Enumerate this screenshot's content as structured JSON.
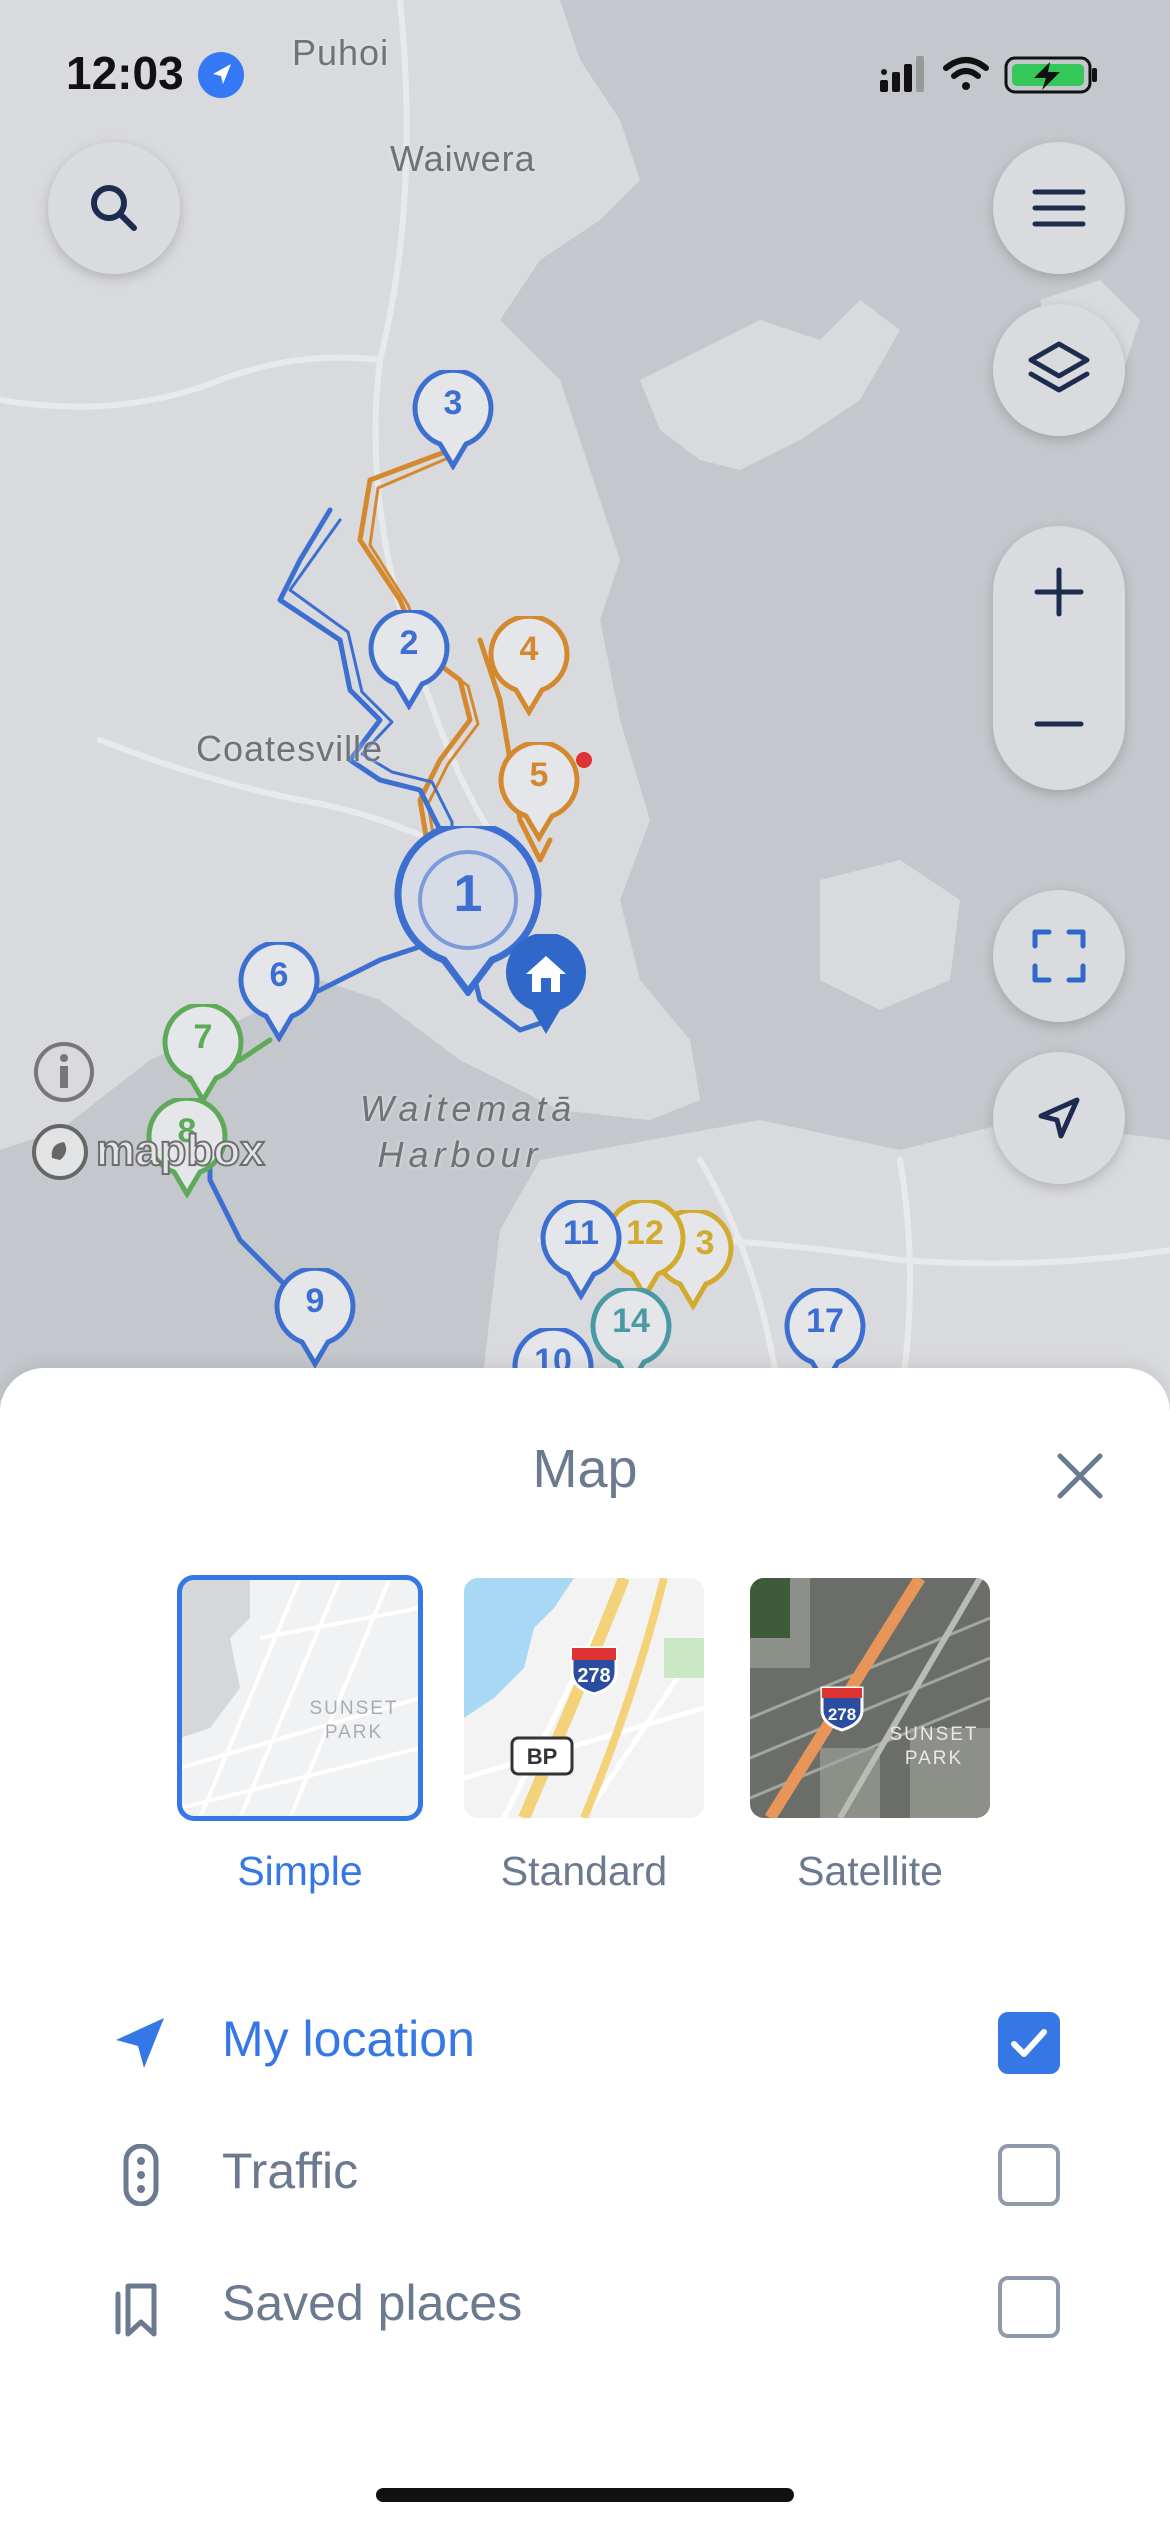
{
  "status_bar": {
    "time": "12:03"
  },
  "map": {
    "place_labels": {
      "puhoi": "Puhoi",
      "waiwera": "Waiwera",
      "coatesville": "Coatesville",
      "harbour_line1": "Waitematā",
      "harbour_line2": "Harbour"
    },
    "attribution": "mapbox",
    "markers": {
      "m1": "1",
      "m2": "2",
      "m3": "3",
      "m4": "4",
      "m5": "5",
      "m6": "6",
      "m7": "7",
      "m8": "8",
      "m9": "9",
      "m10": "10",
      "m11": "11",
      "m12": "12",
      "m13": "3",
      "m14": "14",
      "m17": "17"
    },
    "colors": {
      "blue": "#3d6fd0",
      "orange": "#d4892e",
      "green": "#5ea95a",
      "yellow": "#d1aa2e",
      "teal": "#4a9aa4"
    }
  },
  "sheet": {
    "title": "Map",
    "styles": [
      {
        "label": "Simple",
        "selected": true,
        "thumb_text": "SUNSET PARK"
      },
      {
        "label": "Standard",
        "selected": false,
        "shield": "278",
        "badge": "BP"
      },
      {
        "label": "Satellite",
        "selected": false,
        "shield": "278",
        "thumb_text": "SUNSET PARK"
      }
    ],
    "options": [
      {
        "label": "My location",
        "checked": true
      },
      {
        "label": "Traffic",
        "checked": false
      },
      {
        "label": "Saved places",
        "checked": false
      }
    ],
    "accent_color": "#3578e5"
  }
}
